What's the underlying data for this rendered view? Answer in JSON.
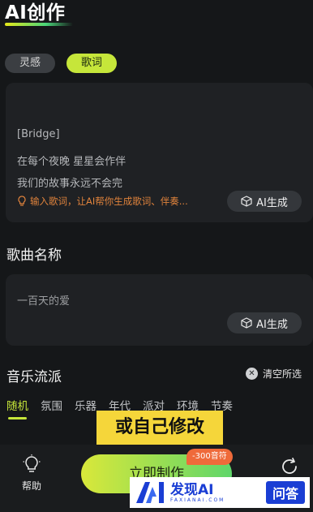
{
  "header": {
    "title": "AI创作"
  },
  "modes": [
    {
      "label": "灵感",
      "active": false
    },
    {
      "label": "歌词",
      "active": true
    }
  ],
  "lyrics": {
    "faded_line": "",
    "lines": [
      "[Bridge]",
      "在每个夜晚 星星会作伴",
      "我们的故事永远不会完"
    ],
    "hint": "输入歌词，让AI帮你生成歌词、伴奏...",
    "ai_button": "AI生成"
  },
  "song_name": {
    "title": "歌曲名称",
    "value": "一百天的爱",
    "ai_button": "AI生成"
  },
  "genre": {
    "title": "音乐流派",
    "clear_label": "清空所选",
    "tabs": [
      {
        "label": "随机",
        "active": true
      },
      {
        "label": "氛围"
      },
      {
        "label": "乐器"
      },
      {
        "label": "年代"
      },
      {
        "label": "派对"
      },
      {
        "label": "环境"
      },
      {
        "label": "节奏"
      }
    ]
  },
  "overlay_caption": "或自己修改",
  "bottom": {
    "help_label": "帮助",
    "make_button": "立即制作",
    "cost_badge": "-300音符"
  },
  "watermark": {
    "main": "发现AI",
    "sub": "FAXIANAI.COM",
    "box": "问答"
  },
  "colors": {
    "accent": "#c6e63a",
    "hint": "#e0833c",
    "badge": "#ef6a3a"
  }
}
